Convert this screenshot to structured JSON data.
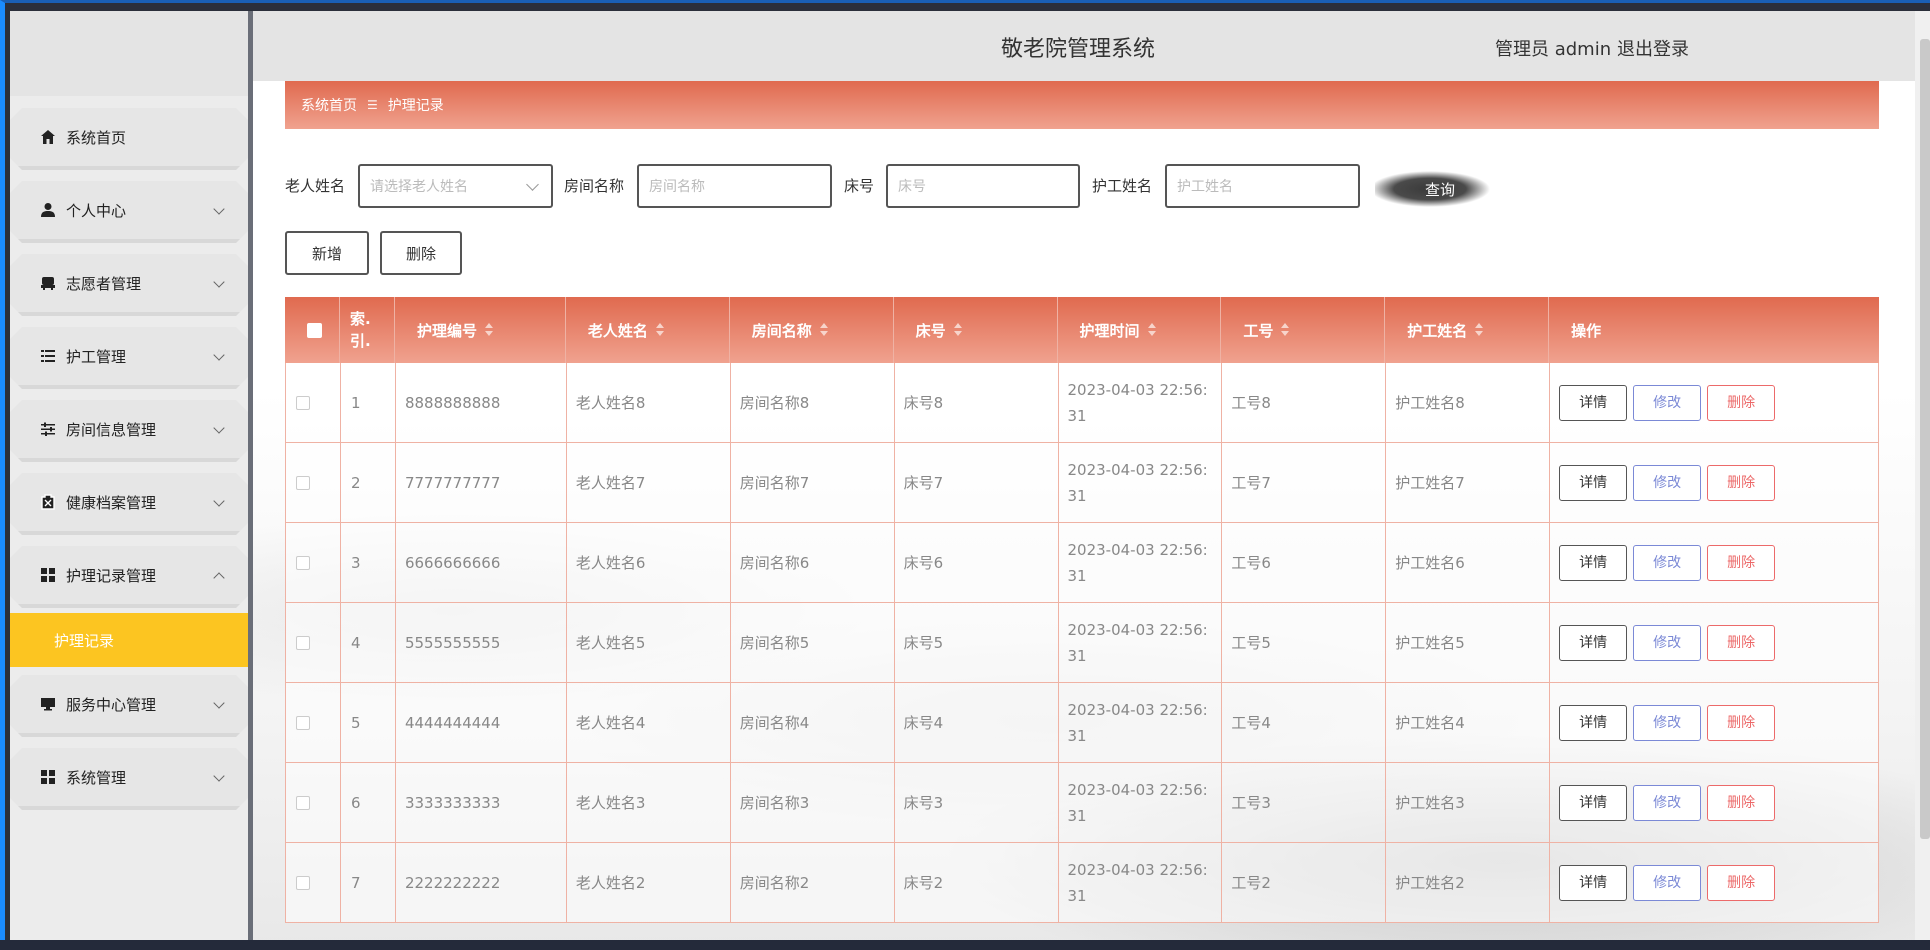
{
  "header": {
    "title": "敬老院管理系统",
    "admin_label": "管理员 admin",
    "logout_label": "退出登录"
  },
  "sidebar": {
    "items": [
      {
        "label": "系统首页",
        "icon": "home-icon",
        "expandable": false
      },
      {
        "label": "个人中心",
        "icon": "user-icon",
        "expandable": true
      },
      {
        "label": "志愿者管理",
        "icon": "volunteer-icon",
        "expandable": true
      },
      {
        "label": "护工管理",
        "icon": "list-icon",
        "expandable": true
      },
      {
        "label": "房间信息管理",
        "icon": "sliders-icon",
        "expandable": true
      },
      {
        "label": "健康档案管理",
        "icon": "clipboard-icon",
        "expandable": true
      },
      {
        "label": "护理记录管理",
        "icon": "grid-icon",
        "expandable": true,
        "expanded": true
      },
      {
        "label": "服务中心管理",
        "icon": "monitor-icon",
        "expandable": true
      },
      {
        "label": "系统管理",
        "icon": "grid-icon",
        "expandable": true
      }
    ],
    "active_sub": "护理记录"
  },
  "breadcrumb": {
    "home": "系统首页",
    "separator": "☰",
    "current": "护理记录"
  },
  "search": {
    "elder_label": "老人姓名",
    "elder_placeholder": "请选择老人姓名",
    "room_label": "房间名称",
    "room_placeholder": "房间名称",
    "bed_label": "床号",
    "bed_placeholder": "床号",
    "worker_label": "护工姓名",
    "worker_placeholder": "护工姓名",
    "query_label": "查询"
  },
  "actions": {
    "add_label": "新增",
    "delete_label": "删除"
  },
  "table": {
    "headers": [
      "索引",
      "护理编号",
      "老人姓名",
      "房间名称",
      "床号",
      "护理时间",
      "工号",
      "护工姓名",
      "操作"
    ],
    "index_header_lines": [
      "索.",
      "引."
    ],
    "row_actions": {
      "detail": "详情",
      "edit": "修改",
      "delete": "删除"
    },
    "rows": [
      {
        "idx": "1",
        "code": "8888888888",
        "elder": "老人姓名8",
        "room": "房间名称8",
        "bed": "床号8",
        "time1": "2023-04-03 22:56:",
        "time2": "31",
        "job": "工号8",
        "worker": "护工姓名8"
      },
      {
        "idx": "2",
        "code": "7777777777",
        "elder": "老人姓名7",
        "room": "房间名称7",
        "bed": "床号7",
        "time1": "2023-04-03 22:56:",
        "time2": "31",
        "job": "工号7",
        "worker": "护工姓名7"
      },
      {
        "idx": "3",
        "code": "6666666666",
        "elder": "老人姓名6",
        "room": "房间名称6",
        "bed": "床号6",
        "time1": "2023-04-03 22:56:",
        "time2": "31",
        "job": "工号6",
        "worker": "护工姓名6"
      },
      {
        "idx": "4",
        "code": "5555555555",
        "elder": "老人姓名5",
        "room": "房间名称5",
        "bed": "床号5",
        "time1": "2023-04-03 22:56:",
        "time2": "31",
        "job": "工号5",
        "worker": "护工姓名5"
      },
      {
        "idx": "5",
        "code": "4444444444",
        "elder": "老人姓名4",
        "room": "房间名称4",
        "bed": "床号4",
        "time1": "2023-04-03 22:56:",
        "time2": "31",
        "job": "工号4",
        "worker": "护工姓名4"
      },
      {
        "idx": "6",
        "code": "3333333333",
        "elder": "老人姓名3",
        "room": "房间名称3",
        "bed": "床号3",
        "time1": "2023-04-03 22:56:",
        "time2": "31",
        "job": "工号3",
        "worker": "护工姓名3"
      },
      {
        "idx": "7",
        "code": "2222222222",
        "elder": "老人姓名2",
        "room": "房间名称2",
        "bed": "床号2",
        "time1": "2023-04-03 22:56:",
        "time2": "31",
        "job": "工号2",
        "worker": "护工姓名2"
      }
    ]
  },
  "colors": {
    "accent": "#e06a4f",
    "active_menu": "#fcc521",
    "edit": "#7b89d6",
    "delete": "#ec6a6a"
  }
}
